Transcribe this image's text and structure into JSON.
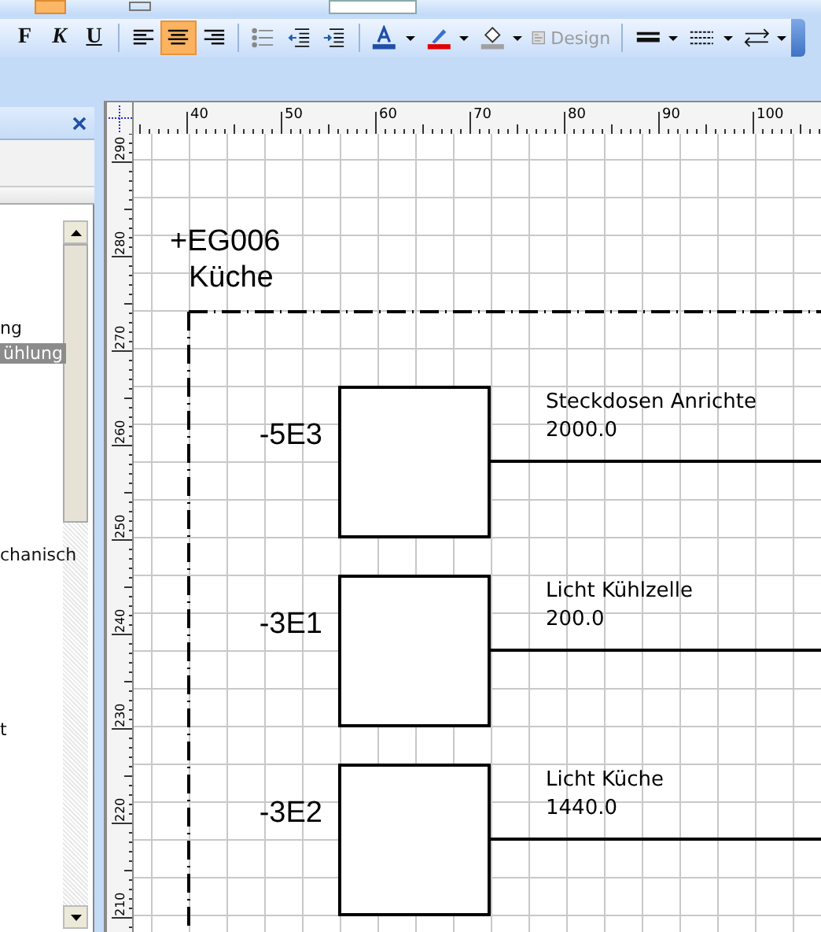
{
  "toolbar": {
    "format": [
      {
        "kind": "bold",
        "label": "F"
      },
      {
        "kind": "italic",
        "label": "K"
      },
      {
        "kind": "underline",
        "label": "U"
      }
    ],
    "alignment": [
      {
        "kind": "align-left",
        "selected": false
      },
      {
        "kind": "align-center",
        "selected": true
      },
      {
        "kind": "align-right",
        "selected": false
      }
    ],
    "paragraph": [
      {
        "kind": "bullets"
      },
      {
        "kind": "outdent"
      },
      {
        "kind": "indent"
      }
    ],
    "colors": [
      {
        "kind": "font-color",
        "color": "#1f4fa8"
      },
      {
        "kind": "highlight",
        "color": "#e00000"
      },
      {
        "kind": "fill",
        "color": "#a0a0a0"
      }
    ],
    "design": {
      "label": "Design",
      "disabled": true
    },
    "lines": [
      {
        "kind": "line-weight"
      },
      {
        "kind": "line-dash"
      },
      {
        "kind": "line-ends"
      }
    ]
  },
  "panel": {
    "items": [
      {
        "label": "ng",
        "selected": false
      },
      {
        "label": "ühlung",
        "selected": true
      },
      {
        "label": "chanisch",
        "selected": false
      },
      {
        "label": "t",
        "selected": false
      }
    ]
  },
  "ruler": {
    "x_labels": [
      "40",
      "50",
      "60",
      "70",
      "80",
      "90",
      "100"
    ],
    "y_labels": [
      "290",
      "280",
      "270",
      "260",
      "250",
      "240",
      "230",
      "220",
      "210"
    ]
  },
  "drawing": {
    "location": {
      "code": "+EG006",
      "name": "Küche"
    },
    "devices": [
      {
        "tag": "-5E3",
        "title": "Steckdosen Anrichte",
        "value": "2000.0"
      },
      {
        "tag": "-3E1",
        "title": "Licht Kühlzelle",
        "value": "200.0"
      },
      {
        "tag": "-3E2",
        "title": "Licht Küche",
        "value": "1440.0"
      }
    ]
  }
}
